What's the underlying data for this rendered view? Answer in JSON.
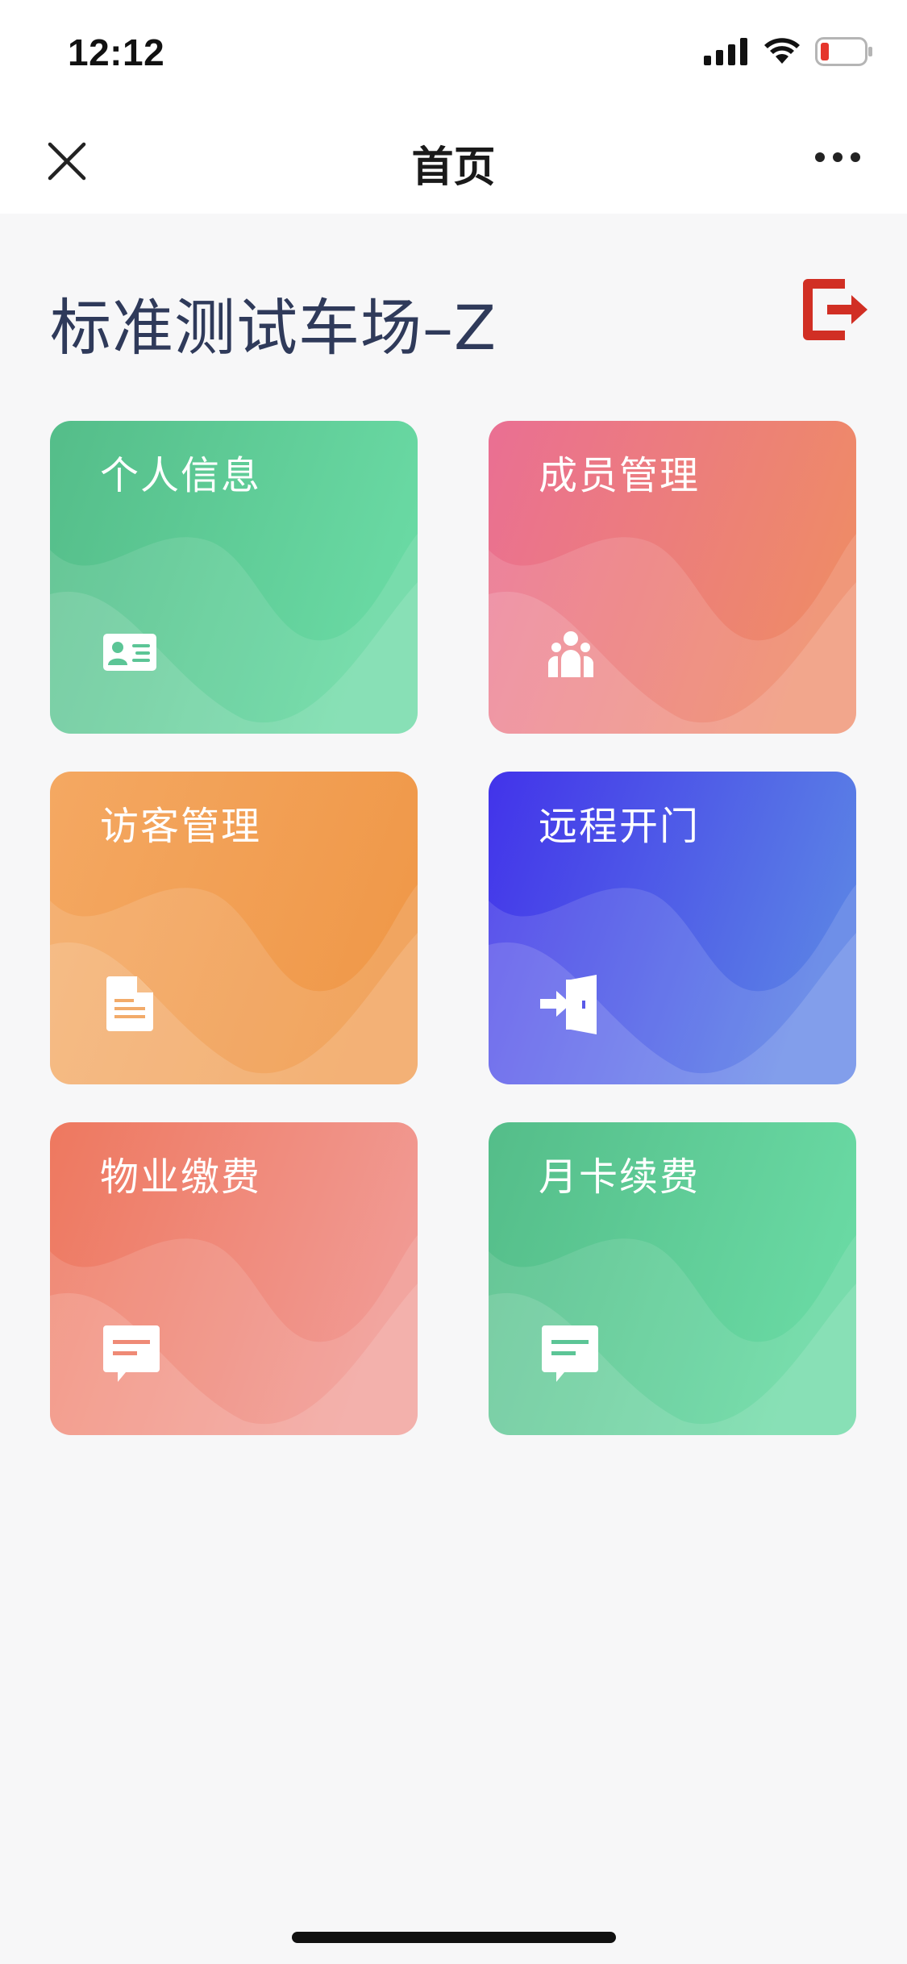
{
  "status_bar": {
    "time": "12:12"
  },
  "nav": {
    "title": "首页"
  },
  "header": {
    "title": "标准测试车场–Z"
  },
  "cards": [
    {
      "label": "个人信息",
      "icon": "id-card-icon",
      "colors": [
        "#56c08f",
        "#6ad9a4"
      ]
    },
    {
      "label": "成员管理",
      "icon": "group-icon",
      "colors": [
        "#ea7093",
        "#ee8a6a"
      ]
    },
    {
      "label": "访客管理",
      "icon": "document-icon",
      "colors": [
        "#f4a45e",
        "#f09a4c"
      ]
    },
    {
      "label": "远程开门",
      "icon": "door-enter-icon",
      "colors": [
        "#4b38ea",
        "#5b7ce6"
      ]
    },
    {
      "label": "物业缴费",
      "icon": "chat-bubble-icon",
      "colors": [
        "#ef7a62",
        "#f19a92"
      ]
    },
    {
      "label": "月卡续费",
      "icon": "chat-bubble-icon",
      "colors": [
        "#56c08f",
        "#6ad9a4"
      ]
    }
  ],
  "colors": {
    "logout_icon": "#d12f24",
    "title_text": "#2f3a5a",
    "background": "#f7f7f8"
  }
}
